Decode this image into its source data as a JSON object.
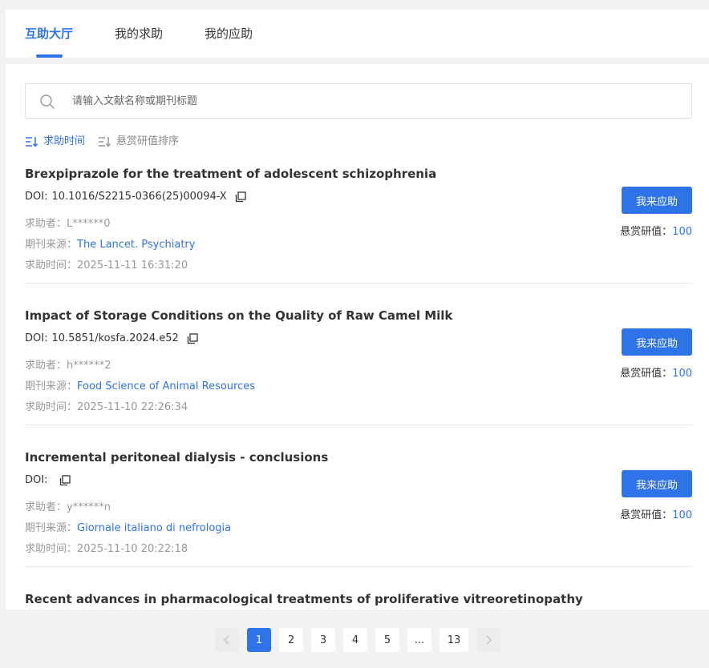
{
  "tabs": [
    {
      "label": "互助大厅",
      "active": true
    },
    {
      "label": "我的求助",
      "active": false
    },
    {
      "label": "我的应助",
      "active": false
    }
  ],
  "search": {
    "placeholder": "请输入文献名称或期刊标题",
    "value": ""
  },
  "sort": [
    {
      "label": "求助时间",
      "active": true
    },
    {
      "label": "悬赏研值排序",
      "active": false
    }
  ],
  "labels": {
    "doi": "DOI:",
    "requester": "求助者：",
    "source": "期刊来源：",
    "time": "求助时间：",
    "respond_button": "我来应助",
    "reward": "悬赏研值："
  },
  "requests": [
    {
      "title": "Brexpiprazole for the treatment of adolescent schizophrenia",
      "doi": "10.1016/S2215-0366(25)00094-X",
      "requester": "L******0",
      "source": "The Lancet. Psychiatry",
      "time": "2025-11-11 16:31:20",
      "reward": "100"
    },
    {
      "title": "Impact of Storage Conditions on the Quality of Raw Camel Milk",
      "doi": "10.5851/kosfa.2024.e52",
      "requester": "h******2",
      "source": "Food Science of Animal Resources",
      "time": "2025-11-10 22:26:34",
      "reward": "100"
    },
    {
      "title": "Incremental peritoneal dialysis - conclusions",
      "doi": "",
      "requester": "y******n",
      "source": "Giornale italiano di nefrologia",
      "time": "2025-11-10 20:22:18",
      "reward": "100"
    },
    {
      "title": "Recent advances in pharmacological treatments of proliferative vitreoretinopathy"
    }
  ],
  "pagination": {
    "pages": [
      "1",
      "2",
      "3",
      "4",
      "5",
      "...",
      "13"
    ],
    "current": "1"
  },
  "colors": {
    "accent": "#2f73e8",
    "background": "#f2f2f2",
    "muted_text": "#999999"
  },
  "icons": {
    "search": "search-icon",
    "sort": "sort-icon",
    "copy": "copy-icon",
    "prev": "chevron-left-icon",
    "next": "chevron-right-icon"
  }
}
